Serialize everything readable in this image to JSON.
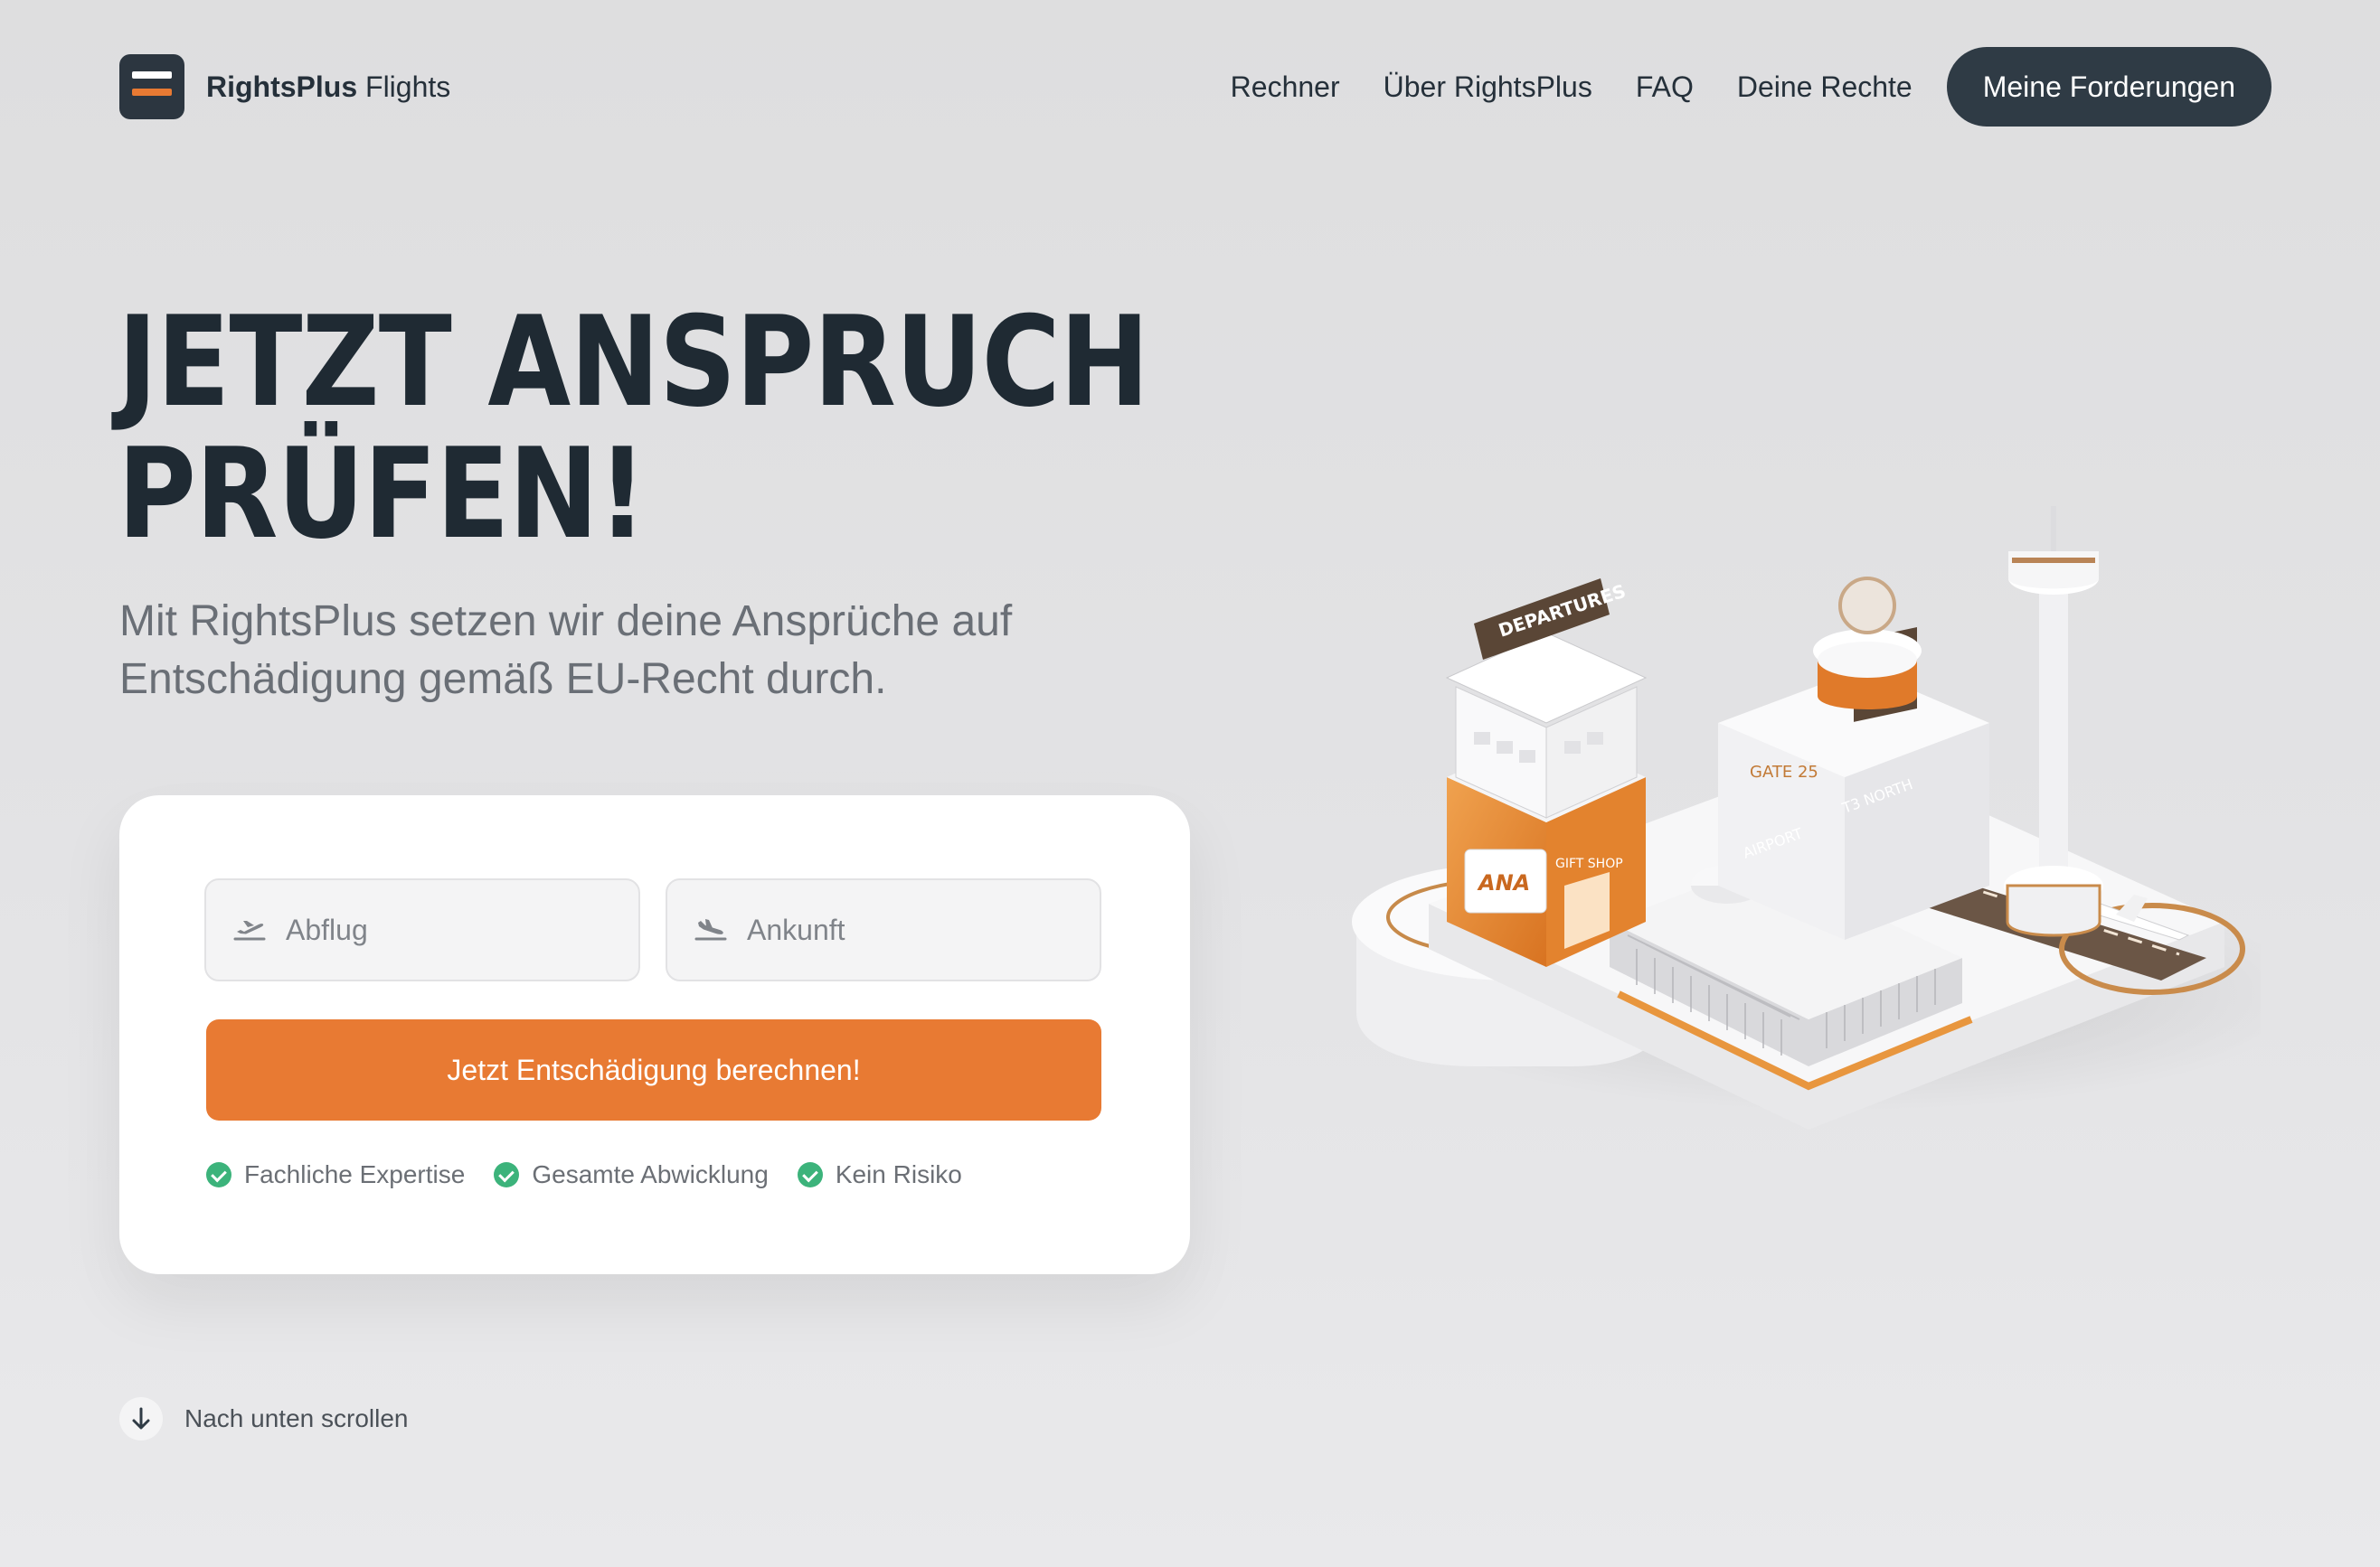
{
  "brand": {
    "name_bold": "RightsPlus",
    "name_light": " Flights"
  },
  "nav": {
    "links": [
      "Rechner",
      "Über RightsPlus",
      "FAQ",
      "Deine Rechte"
    ],
    "cta_label": "Meine Forderungen"
  },
  "hero": {
    "title_line1": "JETZT ANSPRUCH",
    "title_line2": "PRÜFEN!",
    "subtitle": "Mit RightsPlus setzen wir deine Ansprüche auf Entschädigung gemäß EU-Recht durch."
  },
  "form": {
    "departure_placeholder": "Abflug",
    "arrival_placeholder": "Ankunft",
    "submit_label": "Jetzt Entschädigung berechnen!",
    "features": [
      "Fachliche Expertise",
      "Gesamte Abwicklung",
      "Kein Risiko"
    ]
  },
  "scroll_hint": "Nach unten scrollen",
  "illustration": {
    "departures_sign": "DEPARTURES",
    "gift_shop": "GIFT SHOP",
    "gate": "GATE 25",
    "airline": "ANA",
    "airport_label": "AIRPORT",
    "terminal_label": "T3 NORTH"
  },
  "colors": {
    "accent": "#e87a33",
    "dark": "#2f3b45",
    "success": "#3cb37b"
  },
  "icons": [
    "logo-icon",
    "takeoff-icon",
    "landing-icon",
    "check-icon",
    "arrow-down-icon"
  ]
}
